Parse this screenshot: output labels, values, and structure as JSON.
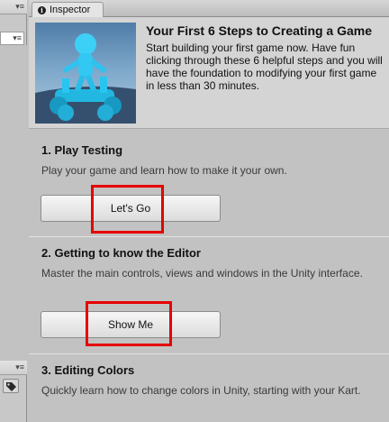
{
  "left_panel": {
    "menu_glyph": "▾≡",
    "tag_icon": "tag-icon"
  },
  "inspector_tab": {
    "label": "Inspector",
    "icon": "info-icon"
  },
  "header": {
    "title": "Your First 6 Steps to Creating a Game",
    "description": "Start building your first game now. Have fun clicking through these 6 helpful steps and you will have the foundation to modifying your first game in less than 30 minutes."
  },
  "sections": [
    {
      "title": "1. Play Testing",
      "description": "Play your game and learn how to make it your own.",
      "button": "Let's Go"
    },
    {
      "title": "2. Getting to know the Editor",
      "description": "Master the main controls, views and windows in the Unity interface.",
      "button": "Show Me"
    },
    {
      "title": "3. Editing Colors",
      "description": "Quickly learn how to change colors in Unity, starting with your Kart."
    }
  ],
  "colors": {
    "highlight": "#e60000",
    "panel_bg": "#c2c2c2",
    "character": "#29c5f0"
  }
}
